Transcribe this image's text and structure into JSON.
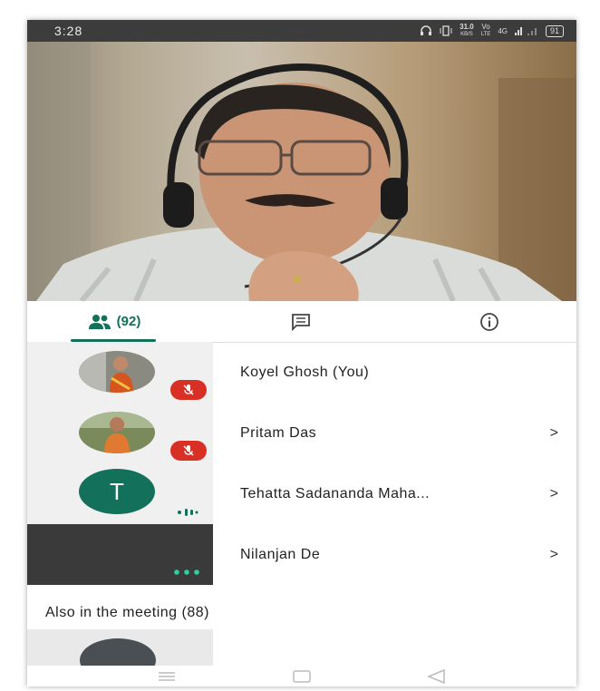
{
  "status_bar": {
    "time": "3:28",
    "speed": "31.0",
    "speed_unit": "KB/S",
    "volte": "Vo",
    "lte": "LTE",
    "network": "4G",
    "battery": "91"
  },
  "tabs": {
    "people_count": "(92)"
  },
  "participants": [
    {
      "name": "Koyel Ghosh (You)",
      "chevron": ""
    },
    {
      "name": "Pritam Das",
      "chevron": ">"
    },
    {
      "name": "Tehatta Sadananda Maha...",
      "chevron": ">",
      "initial": "T"
    },
    {
      "name": "Nilanjan De",
      "chevron": ">"
    }
  ],
  "also_in_meeting": "Also in the meeting (88)",
  "colors": {
    "accent": "#12705b",
    "mute": "#d93025"
  },
  "icons": [
    "headphones-icon",
    "vibrate-icon",
    "signal-icon",
    "battery-icon",
    "people-icon",
    "chat-icon",
    "info-icon",
    "mic-off-icon",
    "audio-wave-icon",
    "more-dots-icon",
    "menu-icon",
    "home-icon",
    "back-icon"
  ]
}
